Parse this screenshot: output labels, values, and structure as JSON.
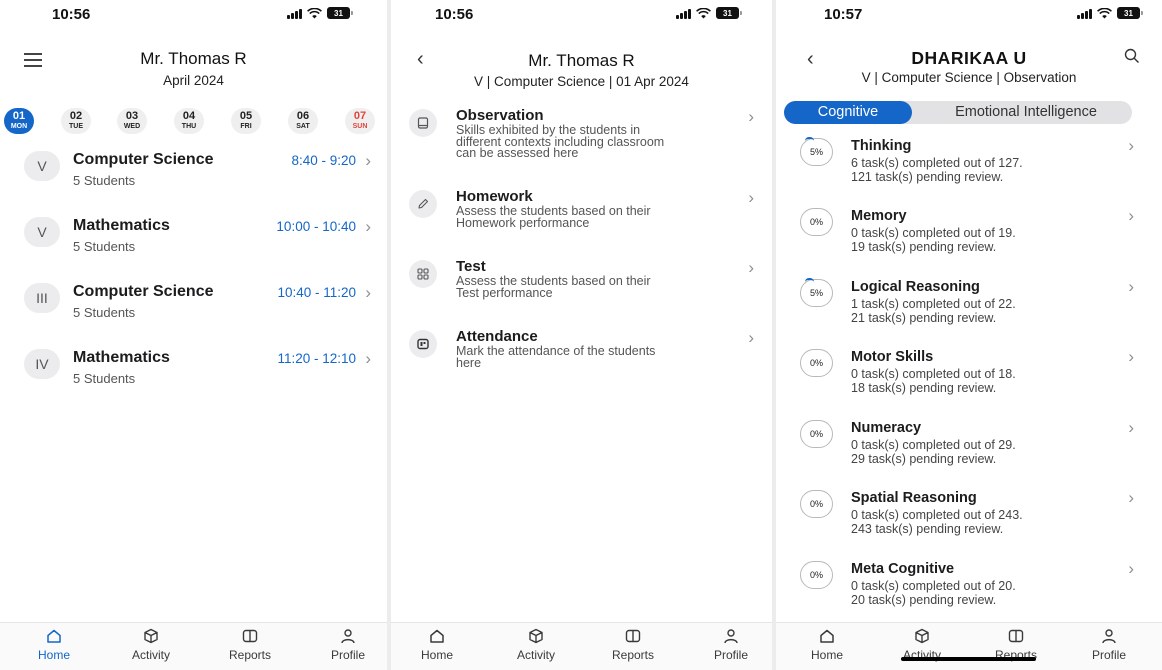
{
  "colors": {
    "accent": "#1466c9",
    "sunday": "#e0453a",
    "muted": "#555555"
  },
  "screen1": {
    "time": "10:56",
    "battery": "31",
    "title": "Mr. Thomas R",
    "subtitle": "April 2024",
    "days": [
      {
        "num": "01",
        "wd": "MON",
        "active": true
      },
      {
        "num": "02",
        "wd": "TUE"
      },
      {
        "num": "03",
        "wd": "WED"
      },
      {
        "num": "04",
        "wd": "THU"
      },
      {
        "num": "05",
        "wd": "FRI"
      },
      {
        "num": "06",
        "wd": "SAT"
      },
      {
        "num": "07",
        "wd": "SUN",
        "sunday": true
      }
    ],
    "classes": [
      {
        "grade": "V",
        "subject": "Computer Science",
        "students": "5 Students",
        "time": "8:40 - 9:20"
      },
      {
        "grade": "V",
        "subject": "Mathematics",
        "students": "5 Students",
        "time": "10:00 - 10:40"
      },
      {
        "grade": "III",
        "subject": "Computer Science",
        "students": "5 Students",
        "time": "10:40 - 11:20"
      },
      {
        "grade": "IV",
        "subject": "Mathematics",
        "students": "5 Students",
        "time": "11:20 - 12:10"
      }
    ]
  },
  "screen2": {
    "time": "10:56",
    "battery": "31",
    "title": "Mr. Thomas R",
    "subtitle": "V | Computer Science | 01 Apr 2024",
    "options": [
      {
        "title": "Observation",
        "desc": [
          "Skills exhibited by the students in",
          "different contexts including classroom",
          "can be assessed here"
        ],
        "icon": "book-icon"
      },
      {
        "title": "Homework",
        "desc": [
          "Assess the students based on their",
          "Homework performance"
        ],
        "icon": "pencil-icon"
      },
      {
        "title": "Test",
        "desc": [
          "Assess the students based on their",
          "Test performance"
        ],
        "icon": "grid-icon"
      },
      {
        "title": "Attendance",
        "desc": [
          "Mark the attendance of the students",
          "here"
        ],
        "icon": "attendance-icon"
      }
    ]
  },
  "screen3": {
    "time": "10:57",
    "battery": "31",
    "title": "DHARIKAA U",
    "subtitle": "V | Computer Science | Observation",
    "tabs": [
      "Cognitive",
      "Emotional Intelligence"
    ],
    "skills": [
      {
        "name": "Thinking",
        "pct": "5%",
        "completed": "6 task(s) completed out of 127.",
        "pending": "121 task(s) pending review."
      },
      {
        "name": "Memory",
        "pct": "0%",
        "completed": "0 task(s) completed out of 19.",
        "pending": "19 task(s) pending review."
      },
      {
        "name": "Logical Reasoning",
        "pct": "5%",
        "completed": "1 task(s) completed out of 22.",
        "pending": "21 task(s) pending review."
      },
      {
        "name": "Motor Skills",
        "pct": "0%",
        "completed": "0 task(s) completed out of 18.",
        "pending": "18 task(s) pending review."
      },
      {
        "name": "Numeracy",
        "pct": "0%",
        "completed": "0 task(s) completed out of 29.",
        "pending": "29 task(s) pending review."
      },
      {
        "name": "Spatial Reasoning",
        "pct": "0%",
        "completed": "0 task(s) completed out of 243.",
        "pending": "243 task(s) pending review."
      },
      {
        "name": "Meta Cognitive",
        "pct": "0%",
        "completed": "0 task(s) completed out of 20.",
        "pending": "20 task(s) pending review."
      }
    ]
  },
  "nav": [
    "Home",
    "Activity",
    "Reports",
    "Profile"
  ]
}
